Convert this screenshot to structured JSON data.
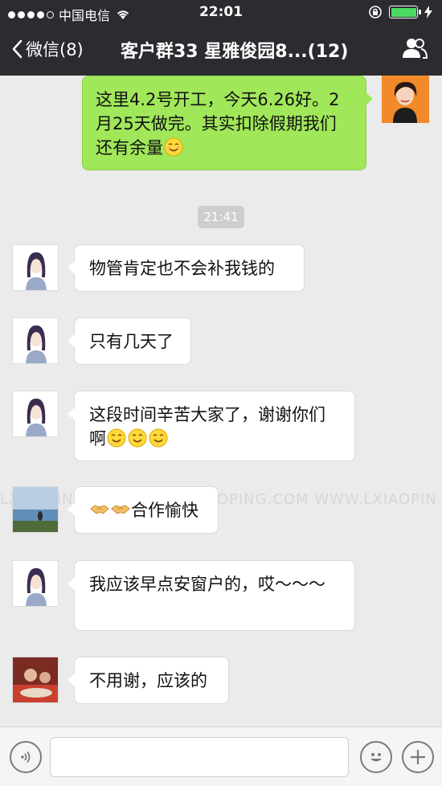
{
  "status_bar": {
    "carrier": "中国电信",
    "time": "22:01"
  },
  "nav": {
    "back_label": "微信(8)",
    "title": "客户群33  星雅俊园8...(12)"
  },
  "messages": [
    {
      "text": "这里4.2号开工，今天6.26好。2月25天做完。其实扣除假期我们还有余量"
    },
    {
      "time": "21:41"
    },
    {
      "text": "物管肯定也不会补我钱的"
    },
    {
      "text": "只有几天了"
    },
    {
      "text": "这段时间辛苦大家了，谢谢你们啊"
    },
    {
      "text": "合作愉快"
    },
    {
      "text": "我应该早点安窗户的，哎～～～"
    },
    {
      "text": "不用谢，应该的"
    }
  ],
  "watermark": "LXIAOPING.COM    WWW.LXIAOPING.COM    WWW.LXIAOPIN",
  "input": {
    "value": "",
    "placeholder": ""
  },
  "icons": {
    "back": "chevron-left-icon",
    "group": "group-members-icon",
    "voice": "voice-icon",
    "emoji": "emoji-icon",
    "plus": "plus-icon",
    "wifi": "wifi-icon",
    "battery": "battery-icon"
  },
  "colors": {
    "nav_bg": "#2b2b30",
    "chat_bg": "#ebebeb",
    "my_bubble": "#a0e75a",
    "their_bubble": "#ffffff",
    "battery": "#4cd964"
  }
}
